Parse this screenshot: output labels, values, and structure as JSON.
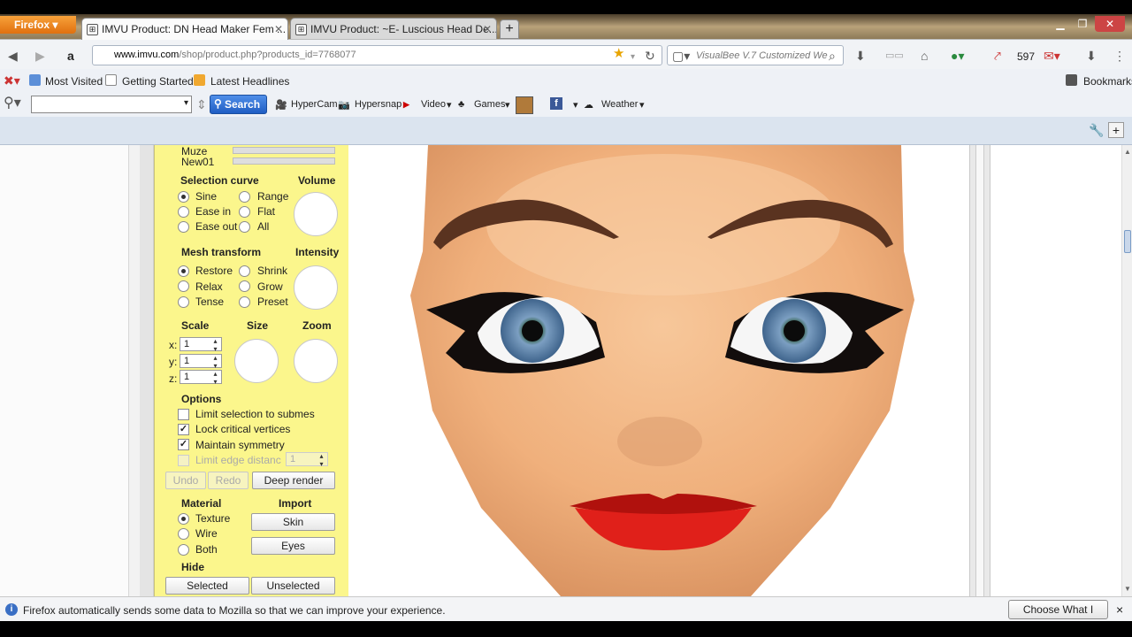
{
  "browser": {
    "app_button": "Firefox",
    "tabs": [
      {
        "label": "IMVU Product: DN Head Maker Fem ...",
        "active": true
      },
      {
        "label": "IMVU Product: ~E- Luscious Head De...",
        "active": false
      }
    ],
    "new_tab": "+",
    "url_host": "www.imvu.com",
    "url_path": "/shop/product.php?products_id=7768077",
    "search_placeholder": "VisualBee V.7 Customized We",
    "counter_badge": "597"
  },
  "bookmarks": {
    "items": [
      "Most Visited",
      "Getting Started",
      "Latest Headlines"
    ],
    "right": "Bookmarks"
  },
  "toolbar": {
    "search_label": "Search",
    "items": [
      "HyperCam",
      "Hypersnap",
      "Video",
      "Games",
      "Weather"
    ]
  },
  "panel": {
    "morph_rows": [
      "Muze",
      "New01"
    ],
    "selection_curve": {
      "title": "Selection curve",
      "options": [
        "Sine",
        "Ease in",
        "Ease out",
        "Range",
        "Flat",
        "All"
      ]
    },
    "volume_label": "Volume",
    "mesh_transform": {
      "title": "Mesh transform",
      "options": [
        "Restore",
        "Relax",
        "Tense",
        "Shrink",
        "Grow",
        "Preset"
      ]
    },
    "intensity_label": "Intensity",
    "scale_label": "Scale",
    "size_label": "Size",
    "zoom_label": "Zoom",
    "scale_axes": [
      {
        "axis": "x:",
        "value": "1"
      },
      {
        "axis": "y:",
        "value": "1"
      },
      {
        "axis": "z:",
        "value": "1"
      }
    ],
    "options_title": "Options",
    "options": [
      {
        "label": "Limit selection to submes",
        "checked": false
      },
      {
        "label": "Lock critical vertices",
        "checked": true
      },
      {
        "label": "Maintain symmetry",
        "checked": true
      },
      {
        "label": "Limit edge distanc",
        "checked": false,
        "disabled": true
      }
    ],
    "edge_distance_value": "1",
    "undo": "Undo",
    "redo": "Redo",
    "deep_render": "Deep render",
    "material_title": "Material",
    "material_options": [
      "Texture",
      "Wire",
      "Both"
    ],
    "import_title": "Import",
    "import_skin": "Skin",
    "import_eyes": "Eyes",
    "hide_title": "Hide",
    "hide_selected": "Selected",
    "hide_unselected": "Unselected"
  },
  "statusbar": {
    "message": "Firefox automatically sends some data to Mozilla so that we can improve your experience.",
    "choose_button": "Choose What I Share",
    "close": "×"
  },
  "colors": {
    "panel_yellow": "#fbf68c",
    "skin": "#f2b98a",
    "lips": "#e0201a",
    "brows": "#5a3320",
    "iris": "#5e86ad"
  },
  "icons": [
    "back-icon",
    "forward-icon",
    "amazon-icon",
    "star-icon",
    "reload-icon",
    "download-icon",
    "home-icon",
    "globe-icon",
    "close-icon"
  ]
}
